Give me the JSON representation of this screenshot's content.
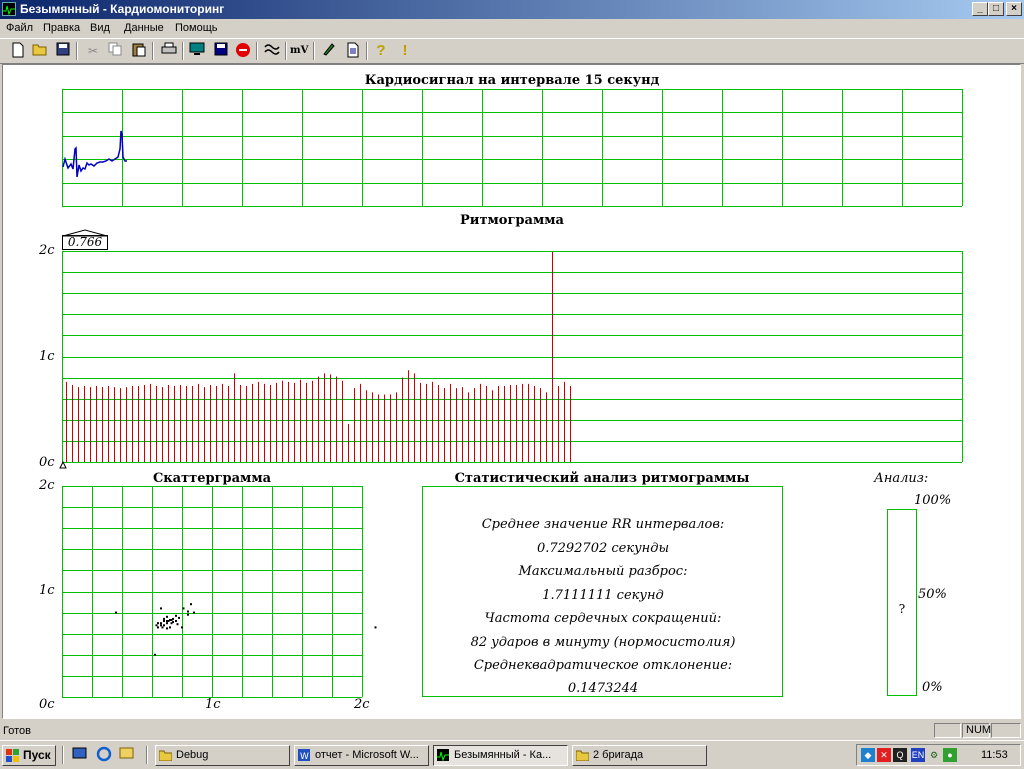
{
  "window": {
    "title": "Безымянный - Кардиомониторинг"
  },
  "menu": [
    "Файл",
    "Правка",
    "Вид",
    "Данные",
    "Помощь"
  ],
  "toolbar": {
    "icons": [
      "new-file-icon",
      "open-folder-icon",
      "save-icon",
      "cut-icon",
      "copy-icon",
      "paste-icon",
      "print-icon",
      "monitor-icon",
      "save-disk-icon",
      "stop-icon",
      "wave-icon",
      "mv-icon",
      "pen-icon",
      "document-icon",
      "help-icon",
      "info-icon"
    ],
    "mv_label": "mV"
  },
  "cardio": {
    "title": "Кардиосигнал на интервале 15 секунд"
  },
  "rhythm": {
    "title": "Ритмограмма",
    "cursor_value": "0.766",
    "y_ticks": [
      "2с",
      "1с",
      "0с"
    ],
    "ylim": [
      0,
      2
    ],
    "bars": [
      0.76,
      0.73,
      0.71,
      0.72,
      0.71,
      0.72,
      0.71,
      0.72,
      0.71,
      0.7,
      0.71,
      0.72,
      0.72,
      0.73,
      0.74,
      0.72,
      0.71,
      0.73,
      0.72,
      0.73,
      0.72,
      0.72,
      0.74,
      0.71,
      0.73,
      0.72,
      0.74,
      0.72,
      0.84,
      0.73,
      0.72,
      0.74,
      0.76,
      0.74,
      0.73,
      0.75,
      0.77,
      0.76,
      0.75,
      0.78,
      0.75,
      0.77,
      0.81,
      0.84,
      0.83,
      0.81,
      0.77,
      0.36,
      0.7,
      0.74,
      0.68,
      0.66,
      0.64,
      0.64,
      0.64,
      0.66,
      0.8,
      0.87,
      0.84,
      0.75,
      0.74,
      0.76,
      0.73,
      0.7,
      0.74,
      0.7,
      0.71,
      0.66,
      0.7,
      0.74,
      0.72,
      0.68,
      0.72,
      0.72,
      0.73,
      0.73,
      0.74,
      0.74,
      0.72,
      0.7,
      0.66,
      1.99,
      0.72,
      0.76,
      0.72
    ],
    "highlight_color": "#cc0000",
    "grid_color": "#00c800"
  },
  "scatter": {
    "title": "Скаттерграмма",
    "y_ticks": [
      "2с",
      "1с",
      "0с"
    ],
    "x_ticks": [
      "1с",
      "2с"
    ],
    "xlim": [
      0,
      2
    ],
    "ylim": [
      0,
      2
    ],
    "points": [
      [
        0.36,
        0.8
      ],
      [
        0.66,
        0.84
      ],
      [
        0.7,
        0.76
      ],
      [
        0.68,
        0.72
      ],
      [
        0.72,
        0.73
      ],
      [
        0.74,
        0.74
      ],
      [
        0.7,
        0.7
      ],
      [
        0.66,
        0.68
      ],
      [
        0.72,
        0.66
      ],
      [
        0.64,
        0.7
      ],
      [
        0.68,
        0.74
      ],
      [
        0.74,
        0.71
      ],
      [
        0.76,
        0.72
      ],
      [
        0.78,
        0.75
      ],
      [
        0.81,
        0.84
      ],
      [
        0.84,
        0.81
      ],
      [
        0.84,
        0.78
      ],
      [
        0.86,
        0.88
      ],
      [
        0.88,
        0.8
      ],
      [
        0.77,
        0.69
      ],
      [
        0.73,
        0.7
      ],
      [
        0.71,
        0.72
      ],
      [
        0.7,
        0.65
      ],
      [
        0.64,
        0.66
      ],
      [
        0.62,
        0.4
      ],
      [
        0.66,
        0.7
      ],
      [
        0.68,
        0.68
      ],
      [
        0.7,
        0.72
      ],
      [
        0.73,
        0.73
      ],
      [
        0.76,
        0.77
      ],
      [
        2.09,
        0.66
      ],
      [
        0.8,
        0.66
      ],
      [
        0.63,
        0.68
      ],
      [
        0.67,
        0.66
      ]
    ]
  },
  "stats": {
    "title": "Статистический анализ ритмограммы",
    "lines": [
      "Среднее значение RR интервалов:",
      "0.7292702 секунды",
      "Максимальный разброс:",
      "1.7111111 секунд",
      "Частота сердечных сокращений:",
      "82 ударов в минуту (нормосистолия)",
      "Среднеквадратическое отклонение:",
      "0.1473244"
    ]
  },
  "analysis": {
    "title": "Анализ:",
    "ticks": [
      "100%",
      "50%",
      "0%"
    ],
    "value_text": "?"
  },
  "statusbar": {
    "text": "Готов",
    "num": "NUM"
  },
  "taskbar": {
    "start": "Пуск",
    "tasks": [
      "Debug",
      "отчет - Microsoft W...",
      "Безымянный - Ка...",
      "2 бригада"
    ],
    "clock": "11:53",
    "lang": "EN"
  }
}
